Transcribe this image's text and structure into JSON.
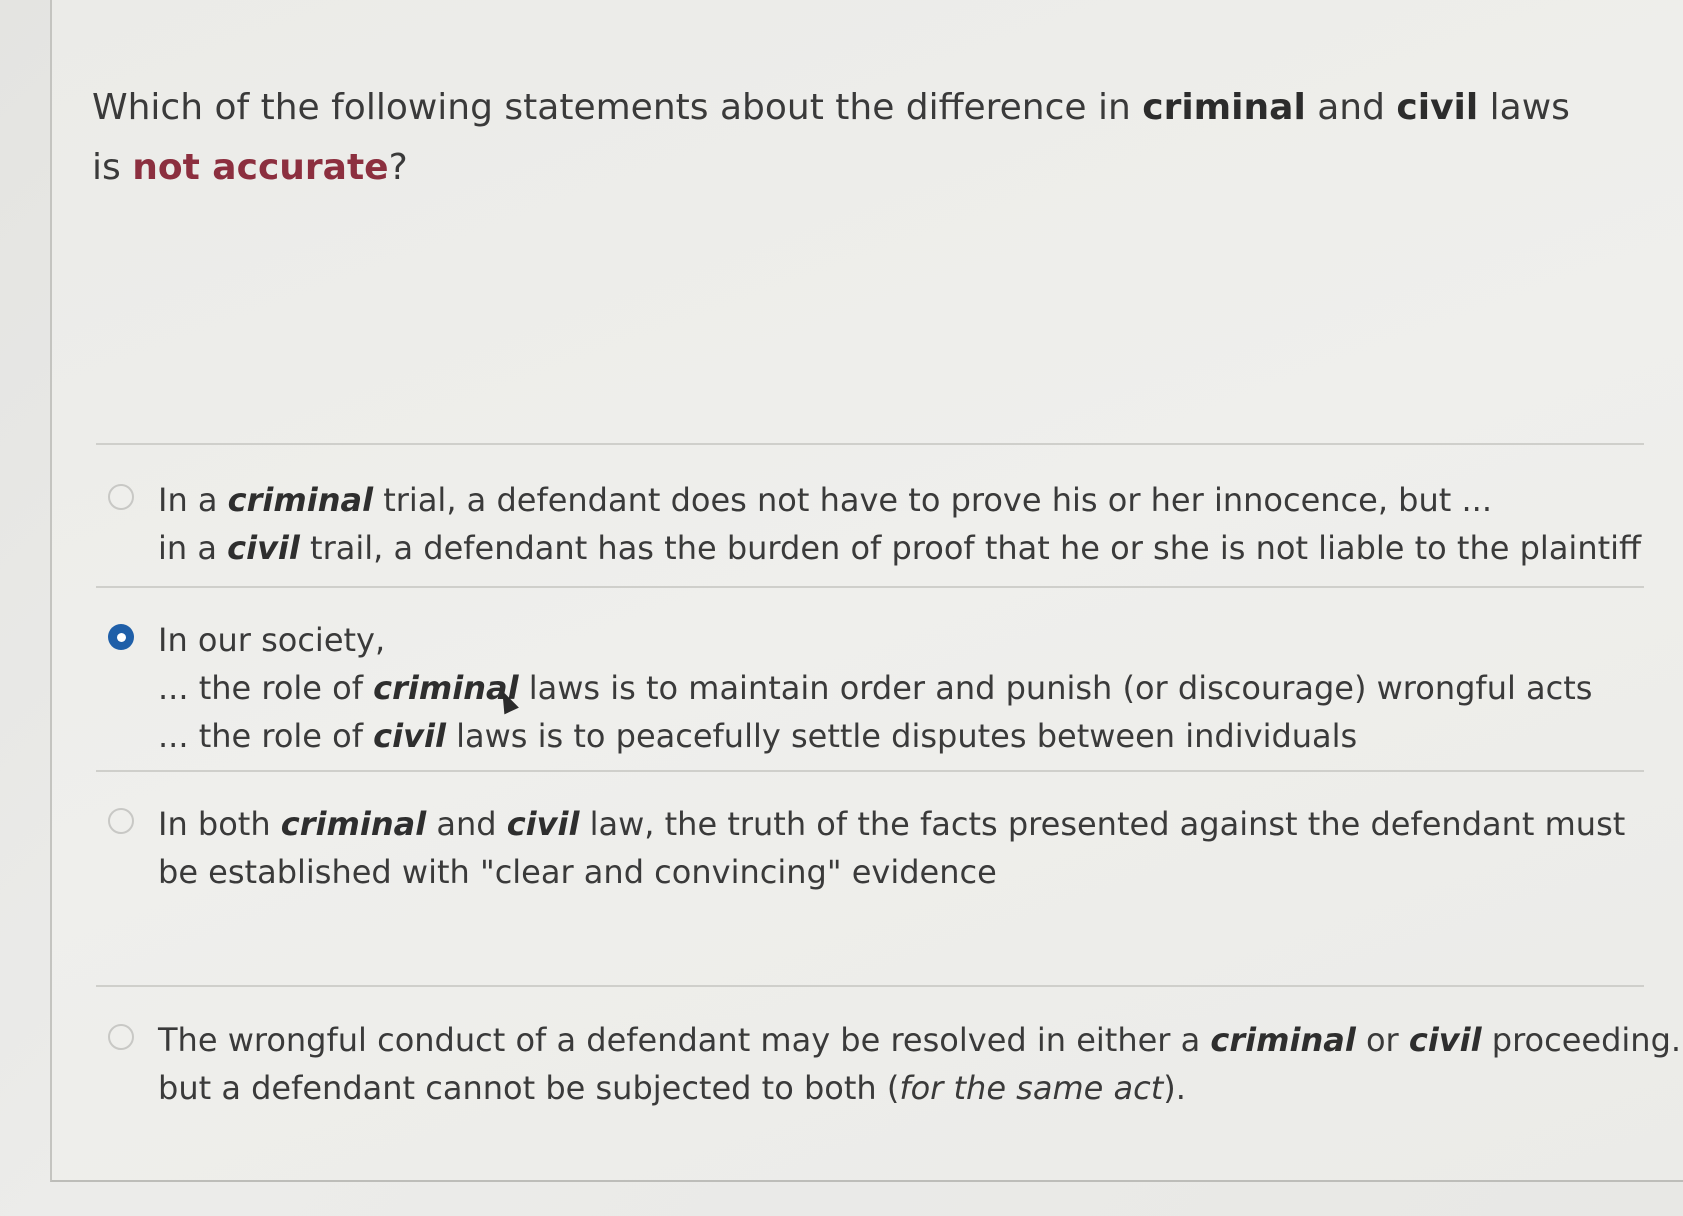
{
  "question": {
    "prefix": "Which of the following statements about the difference in ",
    "bold1": "criminal",
    "mid1": " and ",
    "bold2": "civil",
    "mid2": " laws is ",
    "neg": "not accurate",
    "suffix": "?"
  },
  "options": [
    {
      "selected": false,
      "lines": [
        {
          "a": "In a ",
          "b": "criminal",
          "c": " trial, a defendant does not have to prove his or her innocence, but ..."
        },
        {
          "a": "in a ",
          "b": "civil",
          "c": " trail, a defendant has the burden of proof that he or she is not liable to the plaintiff"
        }
      ]
    },
    {
      "selected": true,
      "lines": [
        {
          "a": "In our society,",
          "b": "",
          "c": ""
        },
        {
          "a": "... the role of ",
          "b": "criminal",
          "c": " laws is to maintain order and punish (or discourage) wrongful acts"
        },
        {
          "a": "... the role of ",
          "b": "civil",
          "c": " laws is to peacefully settle disputes between individuals"
        }
      ]
    },
    {
      "selected": false,
      "lines": [
        {
          "a": "In both ",
          "b": "criminal",
          "c": " and ",
          "d": "civil",
          "e": " law, the truth of the facts presented against the defendant must"
        },
        {
          "a": "be established with \"clear and convincing\" evidence",
          "b": "",
          "c": ""
        }
      ]
    },
    {
      "selected": false,
      "lines": [
        {
          "a": "The wrongful conduct of a defendant may be resolved in either a ",
          "b": "criminal",
          "c": " or ",
          "d": "civil",
          "e": " proceeding..."
        },
        {
          "a": "but a defendant cannot be subjected to both (",
          "f": "for the same act",
          "g": ")."
        }
      ]
    }
  ],
  "colors": {
    "selected_radio": "#1f5fa8",
    "negation_text": "#8c2f3f"
  }
}
